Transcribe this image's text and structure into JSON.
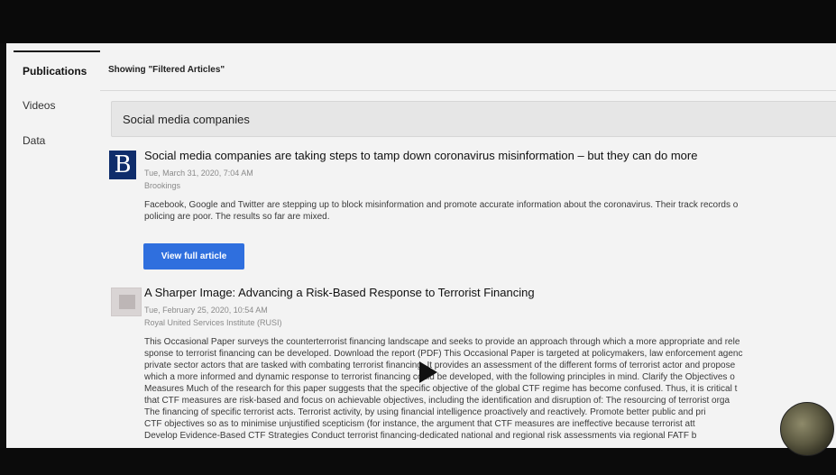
{
  "sidebar": {
    "items": [
      {
        "label": "Publications",
        "active": true
      },
      {
        "label": "Videos",
        "active": false
      },
      {
        "label": "Data",
        "active": false
      }
    ]
  },
  "main": {
    "showing_text": "Showing \"Filtered Articles\"",
    "search": {
      "value": "Social media companies"
    },
    "articles": [
      {
        "title": "Social media companies are taking steps to tamp down coronavirus misinformation – but they can do more",
        "date": "Tue, March 31, 2020, 7:04 AM",
        "source": "Brookings",
        "logo_letter": "B",
        "summary": "Facebook, Google and Twitter are stepping up to block misinformation and promote accurate information about the coronavirus. Their track records o\npolicing are poor. The results so far are mixed.",
        "button_label": "View full article"
      },
      {
        "title": "A Sharper Image: Advancing a Risk-Based Response to Terrorist Financing",
        "date": "Tue, February 25, 2020, 10:54 AM",
        "source": "Royal United Services Institute (RUSI)",
        "summary": "This Occasional Paper surveys the counterterrorist financing landscape and seeks to provide an approach through which a more appropriate and rele\nsponse to terrorist financing can be developed. Download the report (PDF) This Occasional Paper is targeted at policymakers, law enforcement agenc\nprivate sector actors that are tasked with combating terrorist financing. It provides an assessment of the different forms of terrorist actor and propose\nwhich a more informed and dynamic response to terrorist financing could be developed, with the following principles in mind. Clarify the Objectives o\nMeasures Much of the research for this paper suggests that the specific objective of the global CTF regime has become confused. Thus, it is critical t\nthat CTF measures are risk-based and focus on achievable objectives, including the identification and disruption of: The resourcing of terrorist orga\nThe financing of specific terrorist acts. Terrorist activity, by using financial intelligence proactively and reactively. Promote better public and pri\nCTF objectives so as to minimise unjustified scepticism (for instance, the argument that CTF measures are ineffective because terrorist att\nDevelop Evidence-Based CTF Strategies Conduct terrorist financing-dedicated national and regional risk assessments via regional FATF b"
      }
    ]
  },
  "colors": {
    "accent_button": "#2f6fde",
    "brookings_logo": "#0f2d6b",
    "background": "#f3f3f3"
  },
  "icons": {
    "video_overlay": "play-icon",
    "corner_avatar": "avatar"
  }
}
